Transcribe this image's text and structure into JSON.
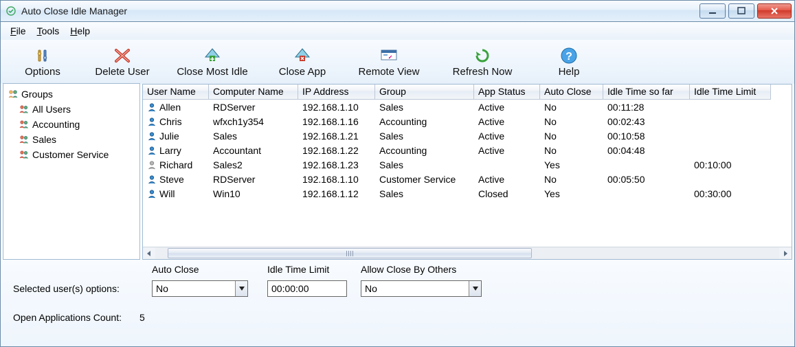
{
  "window": {
    "title": "Auto Close Idle Manager"
  },
  "menu": {
    "file": "File",
    "tools": "Tools",
    "help": "Help"
  },
  "toolbar": {
    "options": "Options",
    "delete_user": "Delete User",
    "close_most_idle": "Close Most Idle",
    "close_app": "Close App",
    "remote_view": "Remote View",
    "refresh_now": "Refresh Now",
    "help": "Help"
  },
  "tree": {
    "root": "Groups",
    "items": [
      "All Users",
      "Accounting",
      "Sales",
      "Customer Service"
    ]
  },
  "grid": {
    "columns": [
      "User Name",
      "Computer Name",
      "IP Address",
      "Group",
      "App Status",
      "Auto Close",
      "Idle Time so far",
      "Idle Time Limit"
    ],
    "rows": [
      {
        "user": "Allen",
        "icon": "active",
        "computer": "RDServer",
        "ip": "192.168.1.10",
        "group": "Sales",
        "status": "Active",
        "auto": "No",
        "idle": "00:11:28",
        "limit": ""
      },
      {
        "user": "Chris",
        "icon": "active",
        "computer": "wfxch1y354",
        "ip": "192.168.1.16",
        "group": "Accounting",
        "status": "Active",
        "auto": "No",
        "idle": "00:02:43",
        "limit": ""
      },
      {
        "user": "Julie",
        "icon": "active",
        "computer": "Sales",
        "ip": "192.168.1.21",
        "group": "Sales",
        "status": "Active",
        "auto": "No",
        "idle": "00:10:58",
        "limit": ""
      },
      {
        "user": "Larry",
        "icon": "active",
        "computer": "Accountant",
        "ip": "192.168.1.22",
        "group": "Accounting",
        "status": "Active",
        "auto": "No",
        "idle": "00:04:48",
        "limit": ""
      },
      {
        "user": "Richard",
        "icon": "inactive",
        "computer": "Sales2",
        "ip": "192.168.1.23",
        "group": "Sales",
        "status": "",
        "auto": "Yes",
        "idle": "",
        "limit": "00:10:00"
      },
      {
        "user": "Steve",
        "icon": "active",
        "computer": "RDServer",
        "ip": "192.168.1.10",
        "group": "Customer Service",
        "status": "Active",
        "auto": "No",
        "idle": "00:05:50",
        "limit": ""
      },
      {
        "user": "Will",
        "icon": "active",
        "computer": "Win10",
        "ip": "192.168.1.12",
        "group": "Sales",
        "status": "Closed",
        "auto": "Yes",
        "idle": "",
        "limit": "00:30:00"
      }
    ]
  },
  "options": {
    "selected_label": "Selected user(s) options:",
    "auto_close": {
      "label": "Auto Close",
      "value": "No"
    },
    "idle_time_limit": {
      "label": "Idle Time Limit",
      "value": "00:00:00"
    },
    "allow_close_by_others": {
      "label": "Allow Close By Others",
      "value": "No"
    },
    "open_apps_label": "Open Applications Count:",
    "open_apps_count": "5"
  }
}
